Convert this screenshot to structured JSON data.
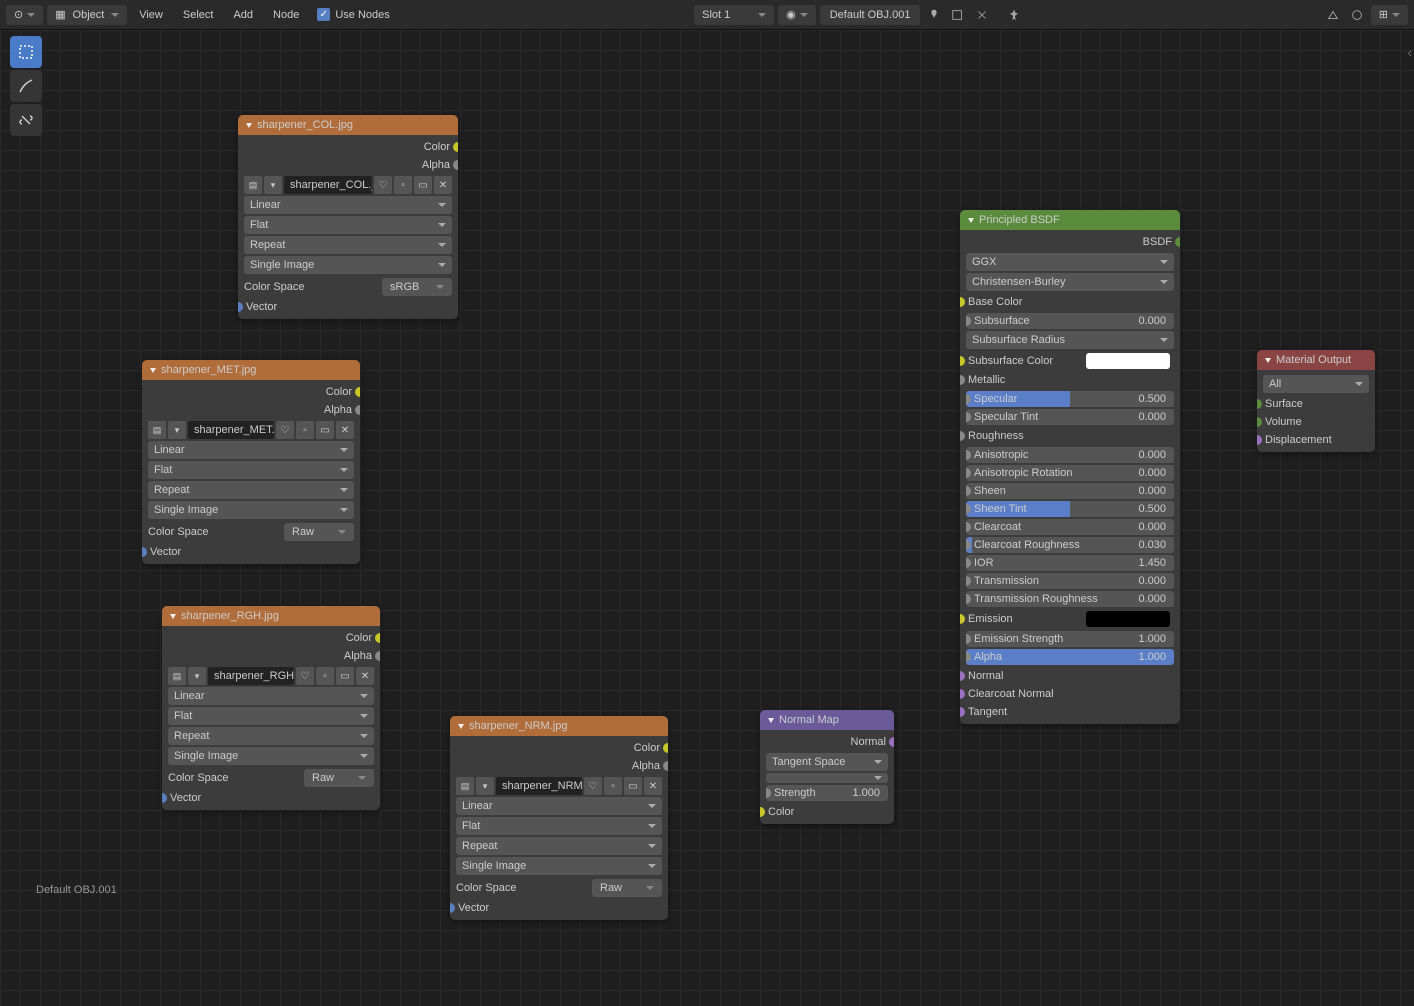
{
  "header": {
    "mode_label": "Object",
    "menus": {
      "view": "View",
      "select": "Select",
      "add": "Add",
      "node": "Node"
    },
    "use_nodes_label": "Use Nodes",
    "slot_label": "Slot 1",
    "material_name": "Default OBJ.001"
  },
  "status_material": "Default OBJ.001",
  "nodes": {
    "col": {
      "title": "sharpener_COL.jpg",
      "out_color": "Color",
      "out_alpha": "Alpha",
      "image_name": "sharpener_COL.j...",
      "interp": "Linear",
      "projection": "Flat",
      "extension": "Repeat",
      "source": "Single Image",
      "colorspace_label": "Color Space",
      "colorspace_value": "sRGB",
      "vector": "Vector"
    },
    "met": {
      "title": "sharpener_MET.jpg",
      "out_color": "Color",
      "out_alpha": "Alpha",
      "image_name": "sharpener_MET.j...",
      "interp": "Linear",
      "projection": "Flat",
      "extension": "Repeat",
      "source": "Single Image",
      "colorspace_label": "Color Space",
      "colorspace_value": "Raw",
      "vector": "Vector"
    },
    "rgh": {
      "title": "sharpener_RGH.jpg",
      "out_color": "Color",
      "out_alpha": "Alpha",
      "image_name": "sharpener_RGH....",
      "interp": "Linear",
      "projection": "Flat",
      "extension": "Repeat",
      "source": "Single Image",
      "colorspace_label": "Color Space",
      "colorspace_value": "Raw",
      "vector": "Vector"
    },
    "nrm": {
      "title": "sharpener_NRM.jpg",
      "out_color": "Color",
      "out_alpha": "Alpha",
      "image_name": "sharpener_NRM....",
      "interp": "Linear",
      "projection": "Flat",
      "extension": "Repeat",
      "source": "Single Image",
      "colorspace_label": "Color Space",
      "colorspace_value": "Raw",
      "vector": "Vector"
    },
    "normalmap": {
      "title": "Normal Map",
      "out_normal": "Normal",
      "space": "Tangent Space",
      "uv_placeholder": "",
      "strength_label": "Strength",
      "strength_value": "1.000",
      "in_color": "Color"
    },
    "bsdf": {
      "title": "Principled BSDF",
      "out": "BSDF",
      "distribution": "GGX",
      "sss_method": "Christensen-Burley",
      "base_color": "Base Color",
      "subsurface": {
        "l": "Subsurface",
        "v": "0.000"
      },
      "subsurface_radius": "Subsurface Radius",
      "subsurface_color": "Subsurface Color",
      "metallic": "Metallic",
      "specular": {
        "l": "Specular",
        "v": "0.500"
      },
      "specular_tint": {
        "l": "Specular Tint",
        "v": "0.000"
      },
      "roughness": "Roughness",
      "anisotropic": {
        "l": "Anisotropic",
        "v": "0.000"
      },
      "anisotropic_rotation": {
        "l": "Anisotropic Rotation",
        "v": "0.000"
      },
      "sheen": {
        "l": "Sheen",
        "v": "0.000"
      },
      "sheen_tint": {
        "l": "Sheen Tint",
        "v": "0.500"
      },
      "clearcoat": {
        "l": "Clearcoat",
        "v": "0.000"
      },
      "clearcoat_roughness": {
        "l": "Clearcoat Roughness",
        "v": "0.030"
      },
      "ior": {
        "l": "IOR",
        "v": "1.450"
      },
      "transmission": {
        "l": "Transmission",
        "v": "0.000"
      },
      "transmission_roughness": {
        "l": "Transmission Roughness",
        "v": "0.000"
      },
      "emission": "Emission",
      "emission_strength": {
        "l": "Emission Strength",
        "v": "1.000"
      },
      "alpha": {
        "l": "Alpha",
        "v": "1.000"
      },
      "normal": "Normal",
      "clearcoat_normal": "Clearcoat Normal",
      "tangent": "Tangent"
    },
    "output": {
      "title": "Material Output",
      "target": "All",
      "surface": "Surface",
      "volume": "Volume",
      "displacement": "Displacement"
    }
  }
}
